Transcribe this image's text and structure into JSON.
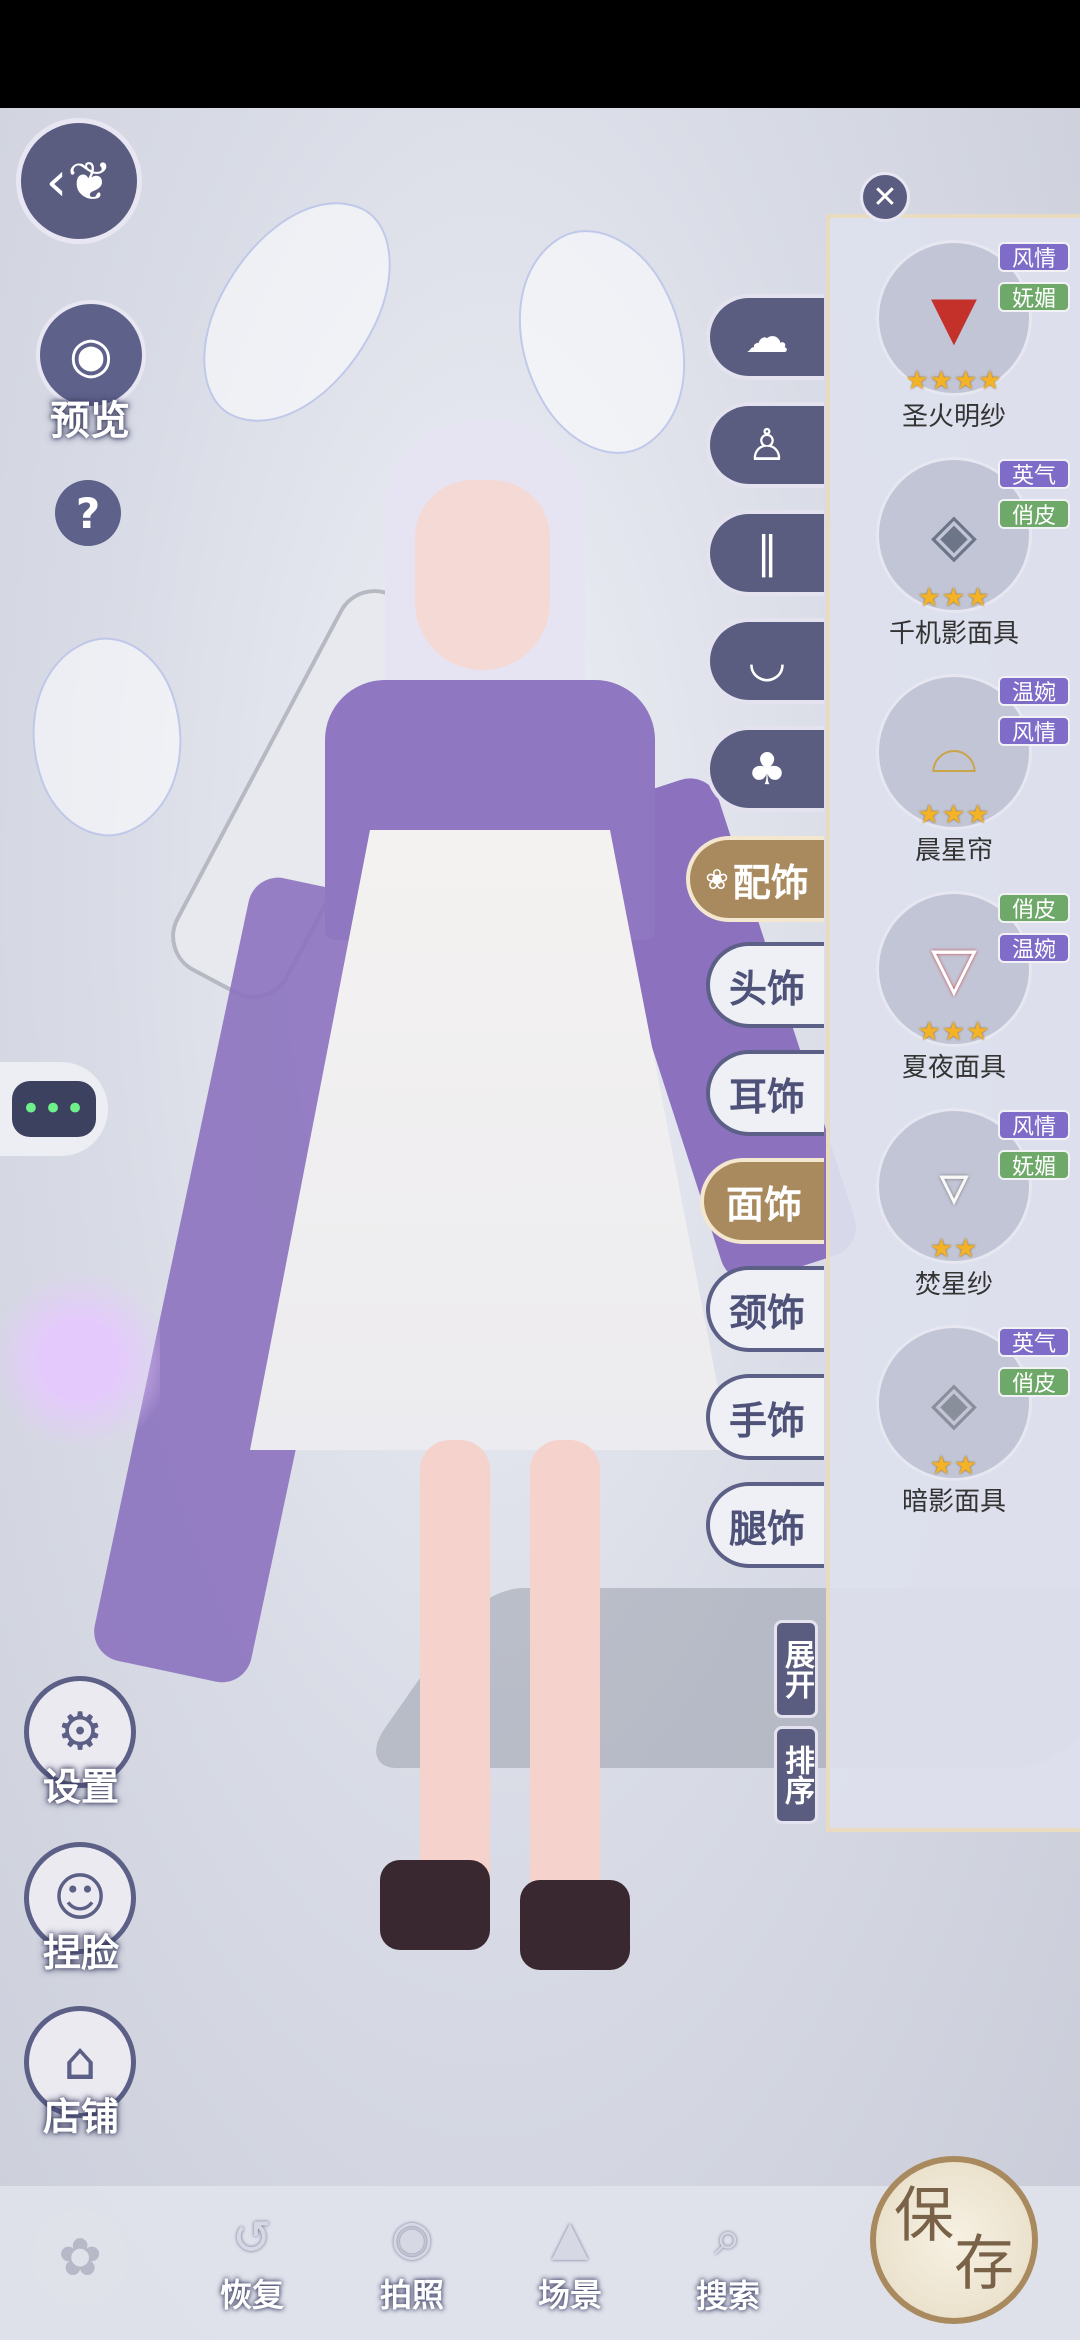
{
  "top_left": {
    "back_icon": "butterfly-back-icon",
    "preview_label": "预览",
    "help_label": "?"
  },
  "chat": {
    "dots": "•••"
  },
  "side_tools": [
    {
      "label": "设置",
      "icon": "settings-icon"
    },
    {
      "label": "捏脸",
      "icon": "face-edit-icon"
    },
    {
      "label": "店铺",
      "icon": "shop-icon"
    }
  ],
  "category_tabs": [
    {
      "icon": "hair-icon",
      "glyph": "☁"
    },
    {
      "icon": "dress-icon",
      "glyph": "♙"
    },
    {
      "icon": "socks-icon",
      "glyph": "∥"
    },
    {
      "icon": "shoes-icon",
      "glyph": "◡"
    },
    {
      "icon": "bell-icon",
      "glyph": "♣"
    }
  ],
  "accessory_tab": {
    "label": "配饰",
    "icon": "accessory-icon"
  },
  "sub_tabs": [
    {
      "label": "头饰",
      "active": false
    },
    {
      "label": "耳饰",
      "active": false
    },
    {
      "label": "面饰",
      "active": true
    },
    {
      "label": "颈饰",
      "active": false
    },
    {
      "label": "手饰",
      "active": false
    },
    {
      "label": "腿饰",
      "active": false
    }
  ],
  "panel_buttons": {
    "expand": "展开",
    "sort": "排序"
  },
  "items": [
    {
      "name": "圣火明纱",
      "stars": "★★★★",
      "tags": [
        {
          "text": "风情",
          "color": "purple"
        },
        {
          "text": "妩媚",
          "color": "green"
        }
      ],
      "icon": "red-veil-icon",
      "glyph": "▼"
    },
    {
      "name": "千机影面具",
      "stars": "★★★",
      "tags": [
        {
          "text": "英气",
          "color": "purple"
        },
        {
          "text": "俏皮",
          "color": "green"
        }
      ],
      "icon": "mask-icon",
      "glyph": "◈"
    },
    {
      "name": "晨星帘",
      "stars": "★★★",
      "tags": [
        {
          "text": "温婉",
          "color": "purple"
        },
        {
          "text": "风情",
          "color": "purple"
        }
      ],
      "icon": "chain-veil-icon",
      "glyph": "⌓"
    },
    {
      "name": "夏夜面具",
      "stars": "★★★",
      "tags": [
        {
          "text": "俏皮",
          "color": "green"
        },
        {
          "text": "温婉",
          "color": "purple"
        }
      ],
      "icon": "fox-mask-icon",
      "glyph": "▽"
    },
    {
      "name": "焚星纱",
      "stars": "★★",
      "tags": [
        {
          "text": "风情",
          "color": "purple"
        },
        {
          "text": "妩媚",
          "color": "green"
        }
      ],
      "icon": "white-veil-icon",
      "glyph": "▿"
    },
    {
      "name": "暗影面具",
      "stars": "★★",
      "tags": [
        {
          "text": "英气",
          "color": "purple"
        },
        {
          "text": "俏皮",
          "color": "green"
        }
      ],
      "icon": "shadow-mask-icon",
      "glyph": "◈"
    }
  ],
  "bottom_nav": [
    {
      "label": "恢复",
      "icon": "restore-icon",
      "glyph": "↺"
    },
    {
      "label": "拍照",
      "icon": "camera-icon",
      "glyph": "◉"
    },
    {
      "label": "场景",
      "icon": "scene-icon",
      "glyph": "▲"
    },
    {
      "label": "搜索",
      "icon": "search-icon",
      "glyph": "⌕"
    }
  ],
  "save_button": {
    "line1": "保",
    "line2": "存"
  },
  "colors": {
    "accent_gold": "#a98a5e",
    "panel_purple": "#5a5d80",
    "tag_purple": "#7f6cc9",
    "tag_green": "#6fa96a",
    "star": "#f4b326"
  }
}
